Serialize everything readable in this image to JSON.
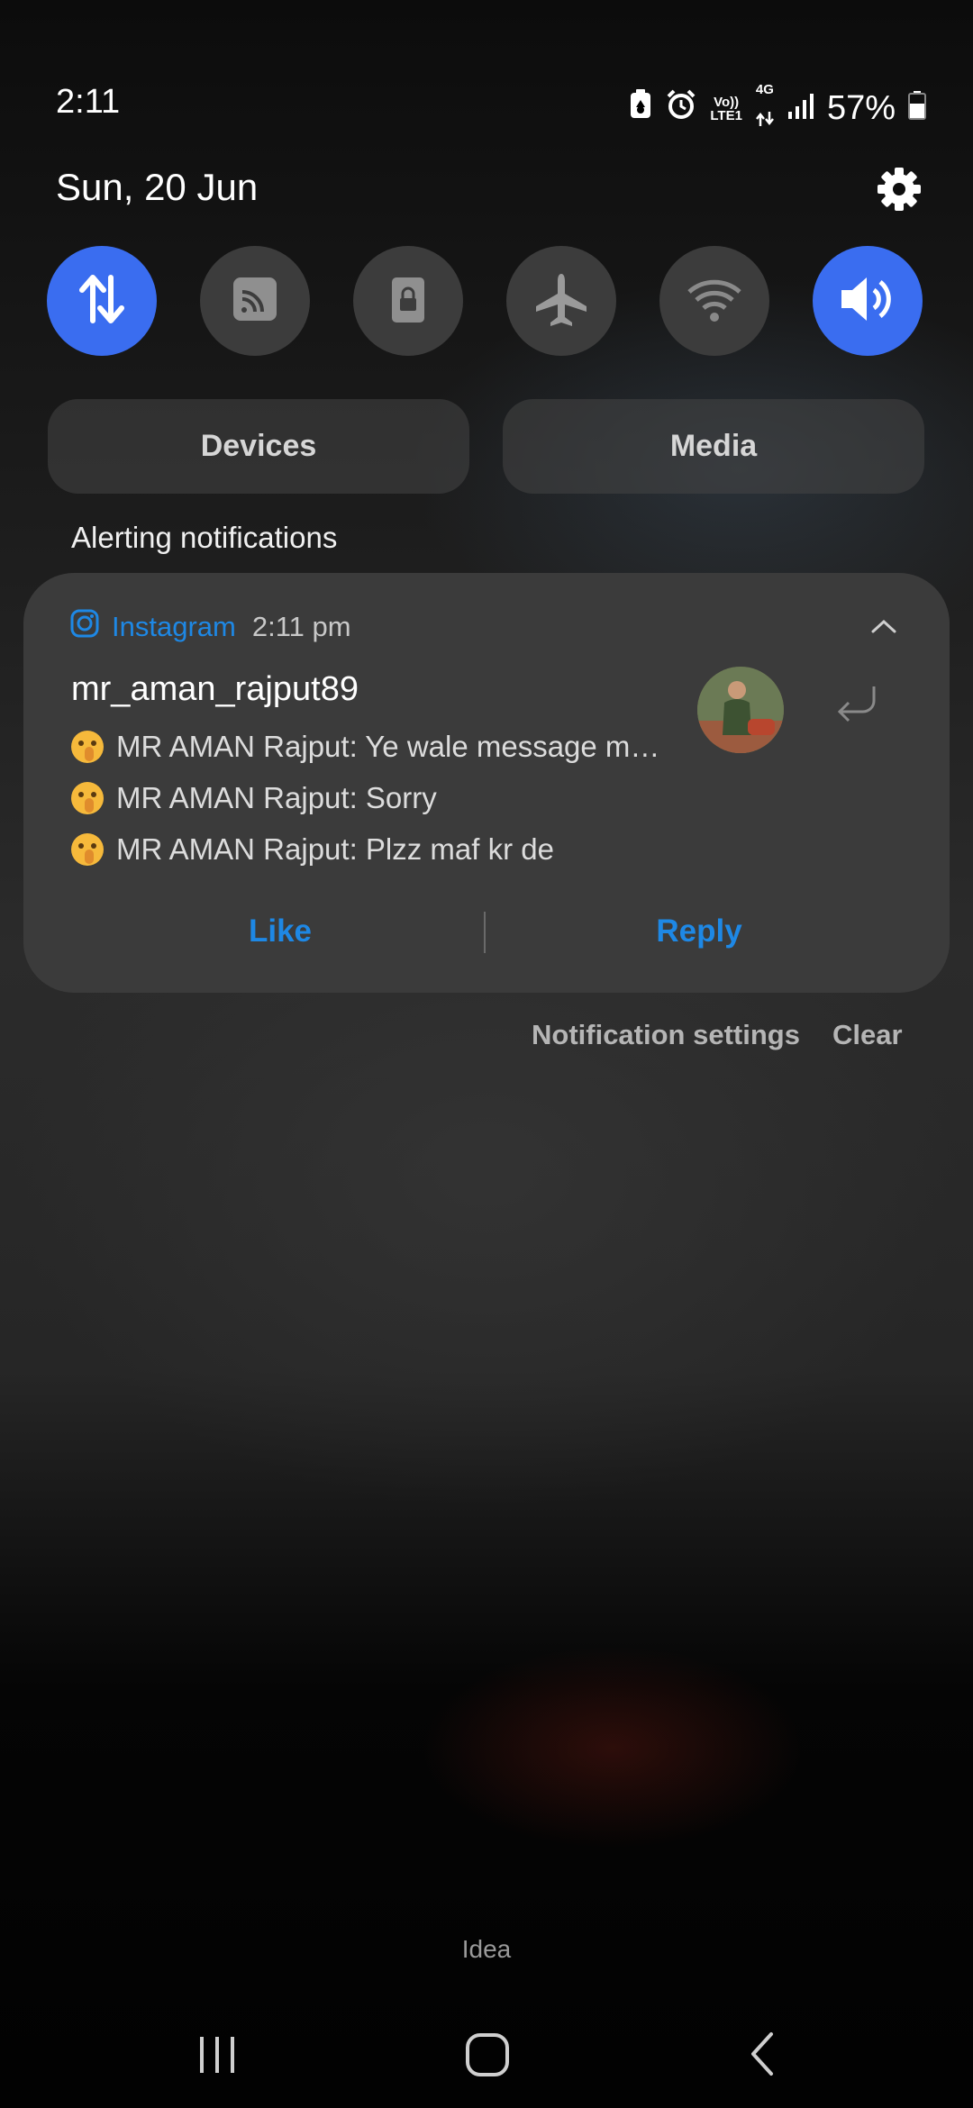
{
  "status_bar": {
    "time": "2:11",
    "volte_label": "Vo))",
    "lte_label": "LTE1",
    "network_type": "4G",
    "battery_percent": "57%",
    "icons": [
      "battery-saver-icon",
      "alarm-icon",
      "volte-icon",
      "mobile-data-4g-icon",
      "signal-icon",
      "battery-icon"
    ]
  },
  "header": {
    "date": "Sun, 20 Jun"
  },
  "quick_toggles": [
    {
      "icon": "mobile-data-icon",
      "on": true
    },
    {
      "icon": "cast-icon",
      "on": false
    },
    {
      "icon": "screen-lock-icon",
      "on": false
    },
    {
      "icon": "airplane-icon",
      "on": false
    },
    {
      "icon": "wifi-icon",
      "on": false
    },
    {
      "icon": "sound-icon",
      "on": true
    }
  ],
  "buttons": {
    "devices": "Devices",
    "media": "Media"
  },
  "section_label": "Alerting notifications",
  "notification": {
    "app_name": "Instagram",
    "time": "2:11 pm",
    "sender": "mr_aman_rajput89",
    "messages": [
      "MR AMAN Rajput: Ye wale message m…",
      "MR AMAN Rajput: Sorry",
      "MR AMAN Rajput: Plzz maf kr de"
    ],
    "actions": {
      "like": "Like",
      "reply": "Reply"
    }
  },
  "footer_actions": {
    "notification_settings": "Notification settings",
    "clear": "Clear"
  },
  "carrier": "Idea",
  "colors": {
    "accent_blue": "#3a6df0",
    "link_blue": "#1e88e5",
    "card_bg": "#3b3b3b"
  }
}
